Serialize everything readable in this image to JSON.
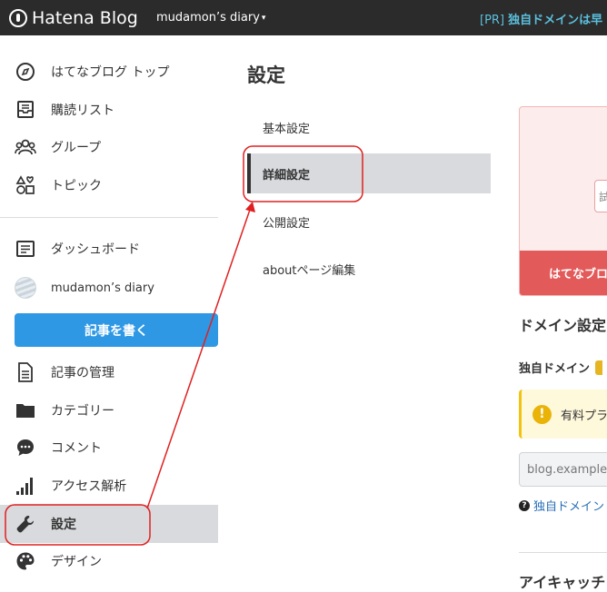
{
  "header": {
    "logo_text": "Hatena Blog",
    "blog_name": "mudamon’s diary",
    "blog_caret": "▾",
    "pr_prefix": "[PR]",
    "pr_text": "独自ドメインは早"
  },
  "sidebar": {
    "top_items": [
      {
        "label": "はてなブログ トップ",
        "icon": "compass-icon"
      },
      {
        "label": "購読リスト",
        "icon": "inbox-icon"
      },
      {
        "label": "グループ",
        "icon": "group-icon"
      },
      {
        "label": "トピック",
        "icon": "topic-shapes-icon"
      }
    ],
    "dashboard": "ダッシュボード",
    "blog_name": "mudamon’s diary",
    "write_button": "記事を書く",
    "bottom_items": [
      {
        "label": "記事の管理",
        "icon": "document-icon"
      },
      {
        "label": "カテゴリー",
        "icon": "folder-icon"
      },
      {
        "label": "コメント",
        "icon": "comment-icon"
      },
      {
        "label": "アクセス解析",
        "icon": "bar-chart-icon"
      },
      {
        "label": "設定",
        "icon": "wrench-icon",
        "active": true
      },
      {
        "label": "デザイン",
        "icon": "palette-icon"
      }
    ]
  },
  "settings": {
    "title": "設定",
    "nav": [
      {
        "label": "基本設定",
        "active": false
      },
      {
        "label": "詳細設定",
        "active": true
      },
      {
        "label": "公開設定",
        "active": false
      },
      {
        "label": "aboutページ編集",
        "active": false
      }
    ]
  },
  "right_pane": {
    "promo_input_text": "試",
    "promo_button": "はてなブロ",
    "domain_title": "ドメイン設定",
    "domain_label": "独自ドメイン",
    "notice_text": "有料プラ",
    "notice_icon": "!",
    "domain_placeholder": "blog.example",
    "help_icon": "?",
    "help_text": "独自ドメイン",
    "eyecatch_title": "アイキャッチ"
  },
  "colors": {
    "topbar": "#2b2b2b",
    "pr_accent": "#5bc0de",
    "write_button": "#2e98e5",
    "active_bg": "#d8dadd",
    "annotation_red": "#e02020",
    "promo_button": "#e35a5a",
    "link": "#2a6fb7"
  }
}
